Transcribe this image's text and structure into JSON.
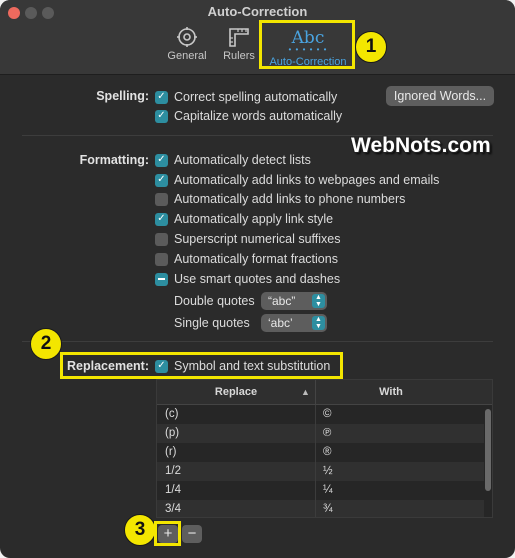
{
  "window": {
    "title": "Auto-Correction"
  },
  "toolbar": {
    "general_label": "General",
    "rulers_label": "Rulers",
    "autocorrection_label": "Auto-Correction",
    "autocorrection_icon_text": "Abc",
    "autocorrection_icon_dots": "• • • • • •"
  },
  "badges": {
    "b1": "1",
    "b2": "2",
    "b3": "3"
  },
  "watermark": "WebNots.com",
  "spelling": {
    "label": "Spelling:",
    "items": [
      {
        "label": "Correct spelling automatically",
        "state": "checked"
      },
      {
        "label": "Capitalize words automatically",
        "state": "checked"
      }
    ],
    "ignored_words_button": "Ignored Words..."
  },
  "formatting": {
    "label": "Formatting:",
    "items": [
      {
        "label": "Automatically detect lists",
        "state": "checked"
      },
      {
        "label": "Automatically add links to webpages and emails",
        "state": "checked"
      },
      {
        "label": "Automatically add links to phone numbers",
        "state": "unchecked"
      },
      {
        "label": "Automatically apply link style",
        "state": "checked"
      },
      {
        "label": "Superscript numerical suffixes",
        "state": "unchecked"
      },
      {
        "label": "Automatically format fractions",
        "state": "unchecked"
      },
      {
        "label": "Use smart quotes and dashes",
        "state": "mixed"
      }
    ],
    "double_quotes_label": "Double quotes",
    "double_quotes_value": "“abc”",
    "single_quotes_label": "Single quotes",
    "single_quotes_value": "‘abc’"
  },
  "replacement": {
    "label": "Replacement:",
    "checkbox_label": "Symbol and text substitution",
    "state": "checked",
    "columns": [
      "Replace",
      "With"
    ],
    "rows": [
      [
        "(c)",
        "©"
      ],
      [
        "(p)",
        "℗"
      ],
      [
        "(r)",
        "®"
      ],
      [
        "1/2",
        "½"
      ],
      [
        "1/4",
        "¼"
      ],
      [
        "3/4",
        "¾"
      ]
    ],
    "add_button": "+",
    "remove_button": "−"
  },
  "colors": {
    "accent": "#2d8ea0",
    "highlight": "#f3e600",
    "window_bg": "#2b2b2b"
  }
}
